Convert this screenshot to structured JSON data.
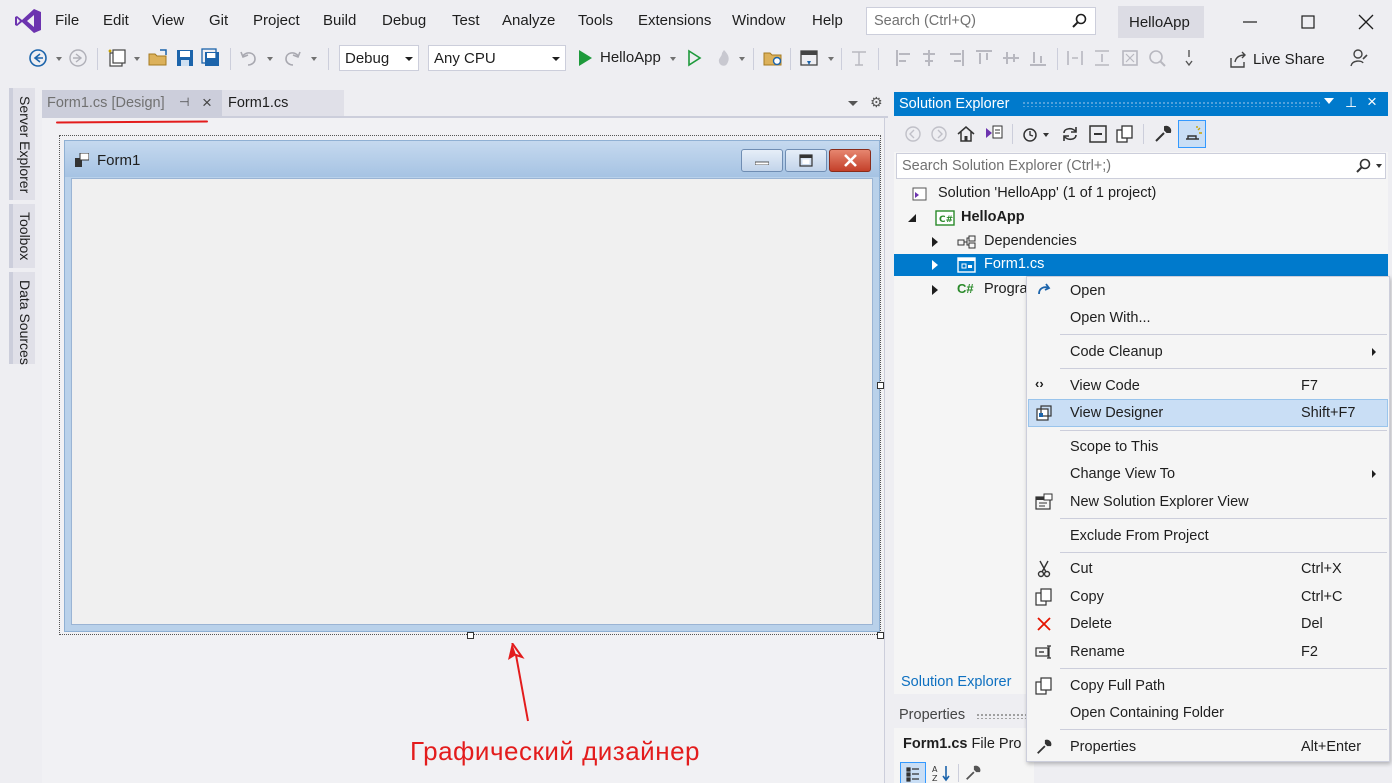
{
  "menu": {
    "items": [
      "File",
      "Edit",
      "View",
      "Git",
      "Project",
      "Build",
      "Debug",
      "Test",
      "Analyze",
      "Tools",
      "Extensions",
      "Window",
      "Help"
    ],
    "search_placeholder": "Search (Ctrl+Q)",
    "app_title": "HelloApp"
  },
  "toolbar": {
    "configuration": "Debug",
    "platform": "Any CPU",
    "run_target": "HelloApp",
    "live_share": "Live Share"
  },
  "side_rail": {
    "tabs": [
      "Server Explorer",
      "Toolbox",
      "Data Sources"
    ]
  },
  "editor": {
    "tabs": [
      {
        "label": "Form1.cs [Design]",
        "active": true
      },
      {
        "label": "Form1.cs",
        "active": false
      }
    ],
    "form_title": "Form1",
    "caption": "Графический дизайнер"
  },
  "solution_explorer": {
    "title": "Solution Explorer",
    "search_placeholder": "Search Solution Explorer (Ctrl+;)",
    "tree": [
      {
        "label": "Solution 'HelloApp' (1 of 1 project)",
        "icon": "solution-icon"
      },
      {
        "label": "HelloApp",
        "icon": "csharp-project-icon",
        "bold": true
      },
      {
        "label": "Dependencies",
        "icon": "dependencies-icon"
      },
      {
        "label": "Form1.cs",
        "icon": "form-file-icon",
        "selected": true
      },
      {
        "label": "Progra",
        "icon": "csharp-file-icon"
      }
    ],
    "bottom_tab": "Solution Explorer"
  },
  "properties": {
    "title": "Properties",
    "object_name": "Form1.cs",
    "object_type": "File Pro"
  },
  "context_menu": {
    "items": [
      {
        "label": "Open",
        "shortcut": "",
        "icon": "open-arrow-icon"
      },
      {
        "label": "Open With...",
        "shortcut": ""
      },
      {
        "label": "Code Cleanup",
        "shortcut": "",
        "submenu": true
      },
      {
        "label": "View Code",
        "shortcut": "F7",
        "icon": "code-brackets-icon"
      },
      {
        "label": "View Designer",
        "shortcut": "Shift+F7",
        "icon": "designer-icon",
        "highlighted": true
      },
      {
        "label": "Scope to This",
        "shortcut": ""
      },
      {
        "label": "Change View To",
        "shortcut": "",
        "submenu": true
      },
      {
        "label": "New Solution Explorer View",
        "shortcut": "",
        "icon": "new-view-icon"
      },
      {
        "label": "Exclude From Project",
        "shortcut": ""
      },
      {
        "label": "Cut",
        "shortcut": "Ctrl+X",
        "icon": "scissors-icon"
      },
      {
        "label": "Copy",
        "shortcut": "Ctrl+C",
        "icon": "copy-icon"
      },
      {
        "label": "Delete",
        "shortcut": "Del",
        "icon": "delete-x-icon"
      },
      {
        "label": "Rename",
        "shortcut": "F2",
        "icon": "rename-icon"
      },
      {
        "label": "Copy Full Path",
        "shortcut": "",
        "icon": "copy-path-icon"
      },
      {
        "label": "Open Containing Folder",
        "shortcut": ""
      },
      {
        "label": "Properties",
        "shortcut": "Alt+Enter",
        "icon": "wrench-icon"
      }
    ]
  },
  "colors": {
    "accent": "#007acc",
    "annotation_red": "#e31c1c",
    "menu_highlight": "#c9def5"
  }
}
